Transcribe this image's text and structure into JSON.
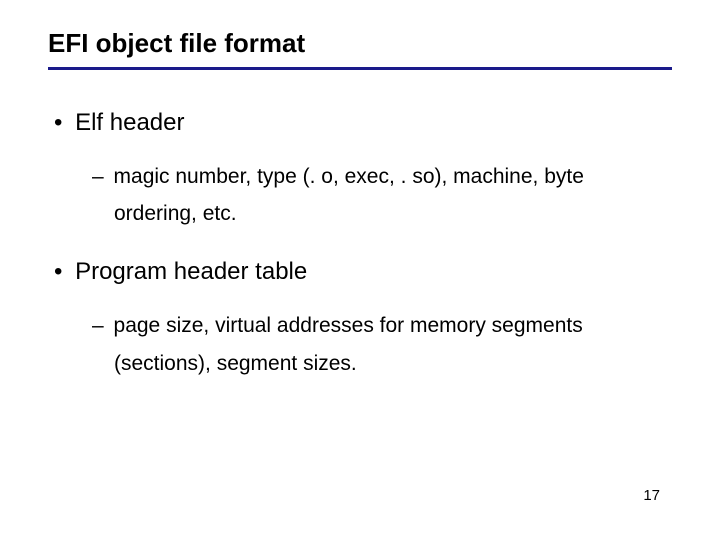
{
  "title": "EFI object file format",
  "bullets": [
    {
      "text": "Elf header",
      "sub": [
        "magic number, type (. o, exec, . so), machine, byte ordering, etc."
      ]
    },
    {
      "text": "Program header table",
      "sub": [
        "page size, virtual addresses for memory segments (sections), segment sizes."
      ]
    }
  ],
  "page_number": "17"
}
